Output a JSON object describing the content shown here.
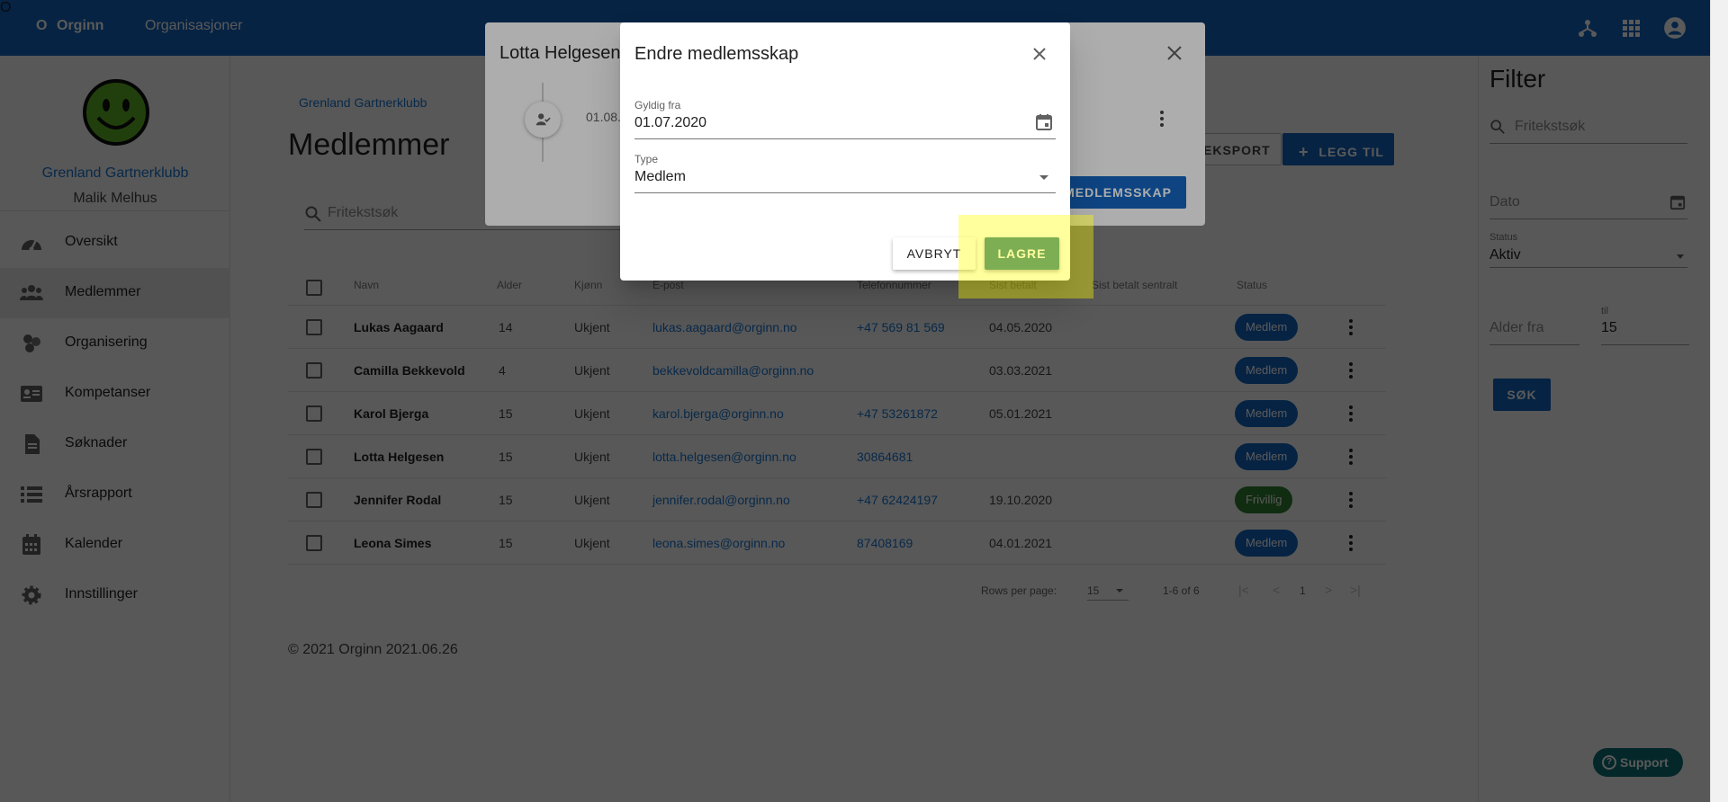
{
  "topbar": {
    "brand_mark": "O",
    "brand": "Orginn",
    "nav_organisations": "Organisasjoner",
    "icons": [
      "hierarchy-icon",
      "apps-grid-icon",
      "account-circle-icon"
    ]
  },
  "sidebar": {
    "club_name": "Grenland Gartnerklubb",
    "user_name": "Malik Melhus",
    "items": [
      {
        "label": "Oversikt",
        "icon": "dashboard-gauge-icon",
        "active": false
      },
      {
        "label": "Medlemmer",
        "icon": "people-icon",
        "active": true
      },
      {
        "label": "Organisering",
        "icon": "organization-icon",
        "active": false
      },
      {
        "label": "Kompetanser",
        "icon": "id-card-icon",
        "active": false
      },
      {
        "label": "Søknader",
        "icon": "document-icon",
        "active": false
      },
      {
        "label": "Årsrapport",
        "icon": "list-icon",
        "active": false
      },
      {
        "label": "Kalender",
        "icon": "calendar-icon",
        "active": false
      },
      {
        "label": "Innstillinger",
        "icon": "gear-icon",
        "active": false
      }
    ]
  },
  "main": {
    "breadcrumb": "Grenland Gartnerklubb",
    "title": "Medlemmer",
    "export_button": "EKSPORT",
    "add_button": "LEGG TIL",
    "search_placeholder": "Fritekstsøk",
    "columns": [
      "Navn",
      "Alder",
      "Kjønn",
      "E-post",
      "Telefonnummer",
      "Sist betalt",
      "Sist betalt sentralt",
      "Status"
    ],
    "rows": [
      {
        "name": "Lukas Aagaard",
        "age": "14",
        "gender": "Ukjent",
        "email": "lukas.aagaard@orginn.no",
        "phone": "+47 569 81 569",
        "last_paid": "04.05.2020",
        "last_paid_central": "",
        "status": "Medlem"
      },
      {
        "name": "Camilla Bekkevold",
        "age": "4",
        "gender": "Ukjent",
        "email": "bekkevoldcamilla@orginn.no",
        "phone": "",
        "last_paid": "03.03.2021",
        "last_paid_central": "",
        "status": "Medlem"
      },
      {
        "name": "Karol Bjerga",
        "age": "15",
        "gender": "Ukjent",
        "email": "karol.bjerga@orginn.no",
        "phone": "+47 53261872",
        "last_paid": "05.01.2021",
        "last_paid_central": "",
        "status": "Medlem"
      },
      {
        "name": "Lotta Helgesen",
        "age": "15",
        "gender": "Ukjent",
        "email": "lotta.helgesen@orginn.no",
        "phone": "30864681",
        "last_paid": "",
        "last_paid_central": "",
        "status": "Medlem"
      },
      {
        "name": "Jennifer Rodal",
        "age": "15",
        "gender": "Ukjent",
        "email": "jennifer.rodal@orginn.no",
        "phone": "+47 62424197",
        "last_paid": "19.10.2020",
        "last_paid_central": "",
        "status": "Frivillig"
      },
      {
        "name": "Leona Simes",
        "age": "15",
        "gender": "Ukjent",
        "email": "leona.simes@orginn.no",
        "phone": "87408169",
        "last_paid": "04.01.2021",
        "last_paid_central": "",
        "status": "Medlem"
      }
    ],
    "pager": {
      "rows_per_page_label": "Rows per page:",
      "rows_per_page": "15",
      "range": "1-6 of 6",
      "page": "1"
    },
    "footer": "© 2021 Orginn 2021.06.26"
  },
  "filter": {
    "title": "Filter",
    "search_placeholder": "Fritekstsøk",
    "date_placeholder": "Dato",
    "status_label": "Status",
    "status_value": "Aktiv",
    "age_from_placeholder": "Alder fra",
    "age_to_label": "til",
    "age_to_value": "15",
    "search_button": "SØK"
  },
  "support": {
    "label": "Support"
  },
  "member_dialog": {
    "title": "Lotta Helgesen",
    "entry_date": "01.08.",
    "membership_button": "MEDLEMSSKAP"
  },
  "edit_dialog": {
    "title": "Endre medlemsskap",
    "valid_from_label": "Gyldig fra",
    "valid_from_value": "01.07.2020",
    "type_label": "Type",
    "type_value": "Medlem",
    "cancel_button": "AVBRYT",
    "save_button": "LAGRE"
  },
  "colors": {
    "primary": "#1565c0",
    "status_member": "#1565c0",
    "status_volunteer": "#2e7d32",
    "save": "#2e7d86",
    "highlight": "#ffff00"
  }
}
